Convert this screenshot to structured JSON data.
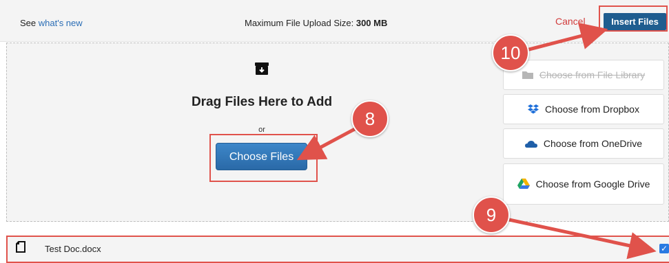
{
  "header": {
    "see_prefix": "See ",
    "whats_new_link": "what's new",
    "max_size_label": "Maximum File Upload Size:",
    "max_size_value": "300 MB",
    "cancel_label": "Cancel",
    "insert_label": "Insert Files"
  },
  "dropzone": {
    "icon": "archive-download-icon",
    "title": "Drag Files Here to Add",
    "or_text": "or",
    "choose_files_label": "Choose Files"
  },
  "sources": [
    {
      "label": "Choose from File Library",
      "icon": "folder-icon",
      "disabled": true
    },
    {
      "label": "Choose from Dropbox",
      "icon": "dropbox-icon",
      "disabled": false
    },
    {
      "label": "Choose from OneDrive",
      "icon": "onedrive-icon",
      "disabled": false
    },
    {
      "label": "Choose from Google Drive",
      "icon": "google-drive-icon",
      "disabled": false
    }
  ],
  "files": [
    {
      "name": "Test Doc.docx",
      "icon": "document-icon",
      "checked": true
    }
  ],
  "annotations": [
    "10",
    "8",
    "9"
  ],
  "colors": {
    "accent_blue": "#2a69a7",
    "insert_blue": "#1f5d8f",
    "cancel_red": "#d13b3b",
    "annotation_red": "#e0524b",
    "link_blue": "#2a6db5",
    "panel_bg": "#f4f4f4"
  }
}
